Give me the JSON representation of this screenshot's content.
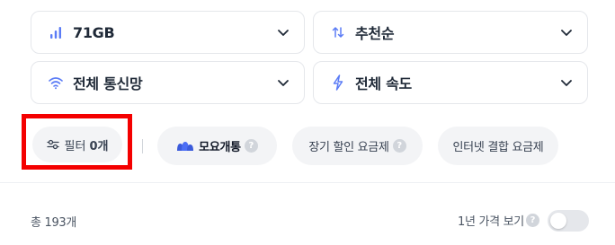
{
  "selects": {
    "data": {
      "label": "71GB",
      "icon": "signal-bars-icon"
    },
    "sort": {
      "label": "추천순",
      "icon": "sort-arrows-icon"
    },
    "network": {
      "label": "전체 통신망",
      "icon": "wifi-icon"
    },
    "speed": {
      "label": "전체 속도",
      "icon": "lightning-icon"
    }
  },
  "filter": {
    "label": "필터",
    "count": "0개",
    "icon": "sliders-icon"
  },
  "chips": {
    "moyo": {
      "label": "모요개통",
      "icon": "moyo-logo-icon",
      "help": "?"
    },
    "long": {
      "label": "장기 할인 요금제",
      "help": "?"
    },
    "inet": {
      "label": "인터넷 결합 요금제"
    }
  },
  "summary": {
    "total": "총 193개",
    "year_view": "1년 가격 보기",
    "help": "?"
  },
  "toggle": {
    "on": false
  },
  "colors": {
    "accent": "#5b7cf6",
    "highlight": "#f40000"
  }
}
